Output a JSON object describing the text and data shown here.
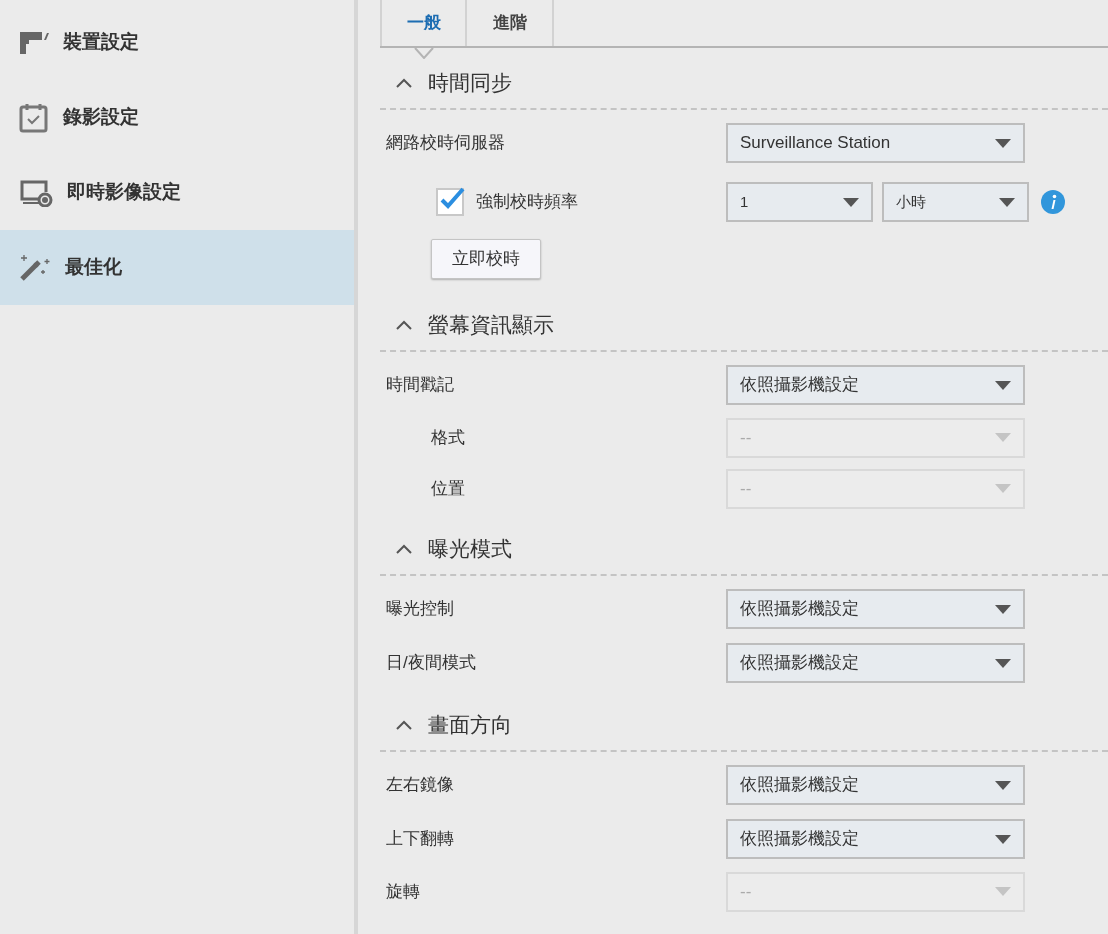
{
  "sidebar": {
    "items": [
      {
        "label": "裝置設定",
        "selected": false
      },
      {
        "label": "錄影設定",
        "selected": false
      },
      {
        "label": "即時影像設定",
        "selected": false
      },
      {
        "label": "最佳化",
        "selected": true
      }
    ]
  },
  "tabs": [
    {
      "label": "一般",
      "selected": true
    },
    {
      "label": "進階",
      "selected": false
    }
  ],
  "sections": [
    {
      "title": "時間同步",
      "expanded": true,
      "rows": [
        {
          "kind": "select",
          "label": "網路校時伺服器",
          "value": "Surveillance Station",
          "disabled": false,
          "indented": false
        },
        {
          "kind": "frequency",
          "label": "強制校時頻率",
          "checked": true,
          "values": [
            "1",
            "小時"
          ]
        },
        {
          "kind": "button",
          "label": "立即校時"
        }
      ]
    },
    {
      "title": "螢幕資訊顯示",
      "expanded": true,
      "rows": [
        {
          "kind": "select",
          "label": "時間戳記",
          "value": "依照攝影機設定",
          "disabled": false,
          "indented": false
        },
        {
          "kind": "select",
          "label": "格式",
          "value": "--",
          "disabled": true,
          "indented": true
        },
        {
          "kind": "select",
          "label": "位置",
          "value": "--",
          "disabled": true,
          "indented": true
        }
      ]
    },
    {
      "title": "曝光模式",
      "expanded": true,
      "rows": [
        {
          "kind": "select",
          "label": "曝光控制",
          "value": "依照攝影機設定",
          "disabled": false,
          "indented": false
        },
        {
          "kind": "select",
          "label": "日/夜間模式",
          "value": "依照攝影機設定",
          "disabled": false,
          "indented": false
        }
      ]
    },
    {
      "title": "畫面方向",
      "expanded": true,
      "rows": [
        {
          "kind": "select",
          "label": "左右鏡像",
          "value": "依照攝影機設定",
          "disabled": false,
          "indented": false
        },
        {
          "kind": "select",
          "label": "上下翻轉",
          "value": "依照攝影機設定",
          "disabled": false,
          "indented": false
        },
        {
          "kind": "select",
          "label": "旋轉",
          "value": "--",
          "disabled": true,
          "indented": false
        }
      ]
    }
  ]
}
